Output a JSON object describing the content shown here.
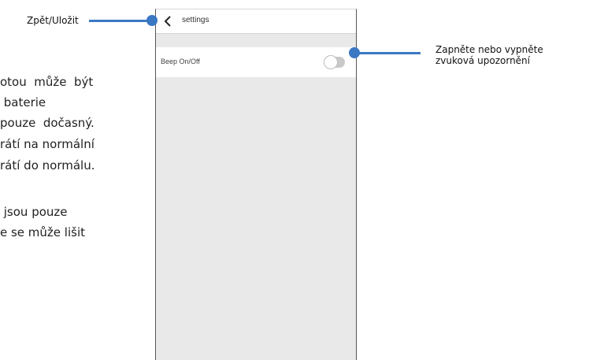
{
  "manual_text": {
    "lines": [
      "otou  může  být",
      " baterie",
      "pouze  dočasný.",
      "rátí na normální",
      "rátí do normálu.",
      " jsou pouze",
      "e se může lišit"
    ]
  },
  "app": {
    "header": {
      "title": "settings",
      "back_icon": "chevron-left-icon"
    },
    "settings_row": {
      "label": "Beep On/Off",
      "toggle_state": "off"
    }
  },
  "callouts": {
    "back": {
      "text": "Zpět/Uložit"
    },
    "beep": {
      "line1": "Zapněte nebo vypněte",
      "line2": "zvuková upozornění"
    }
  },
  "colors": {
    "callout_blue": "#3b78c4",
    "screen_bg": "#e9e9e9"
  }
}
